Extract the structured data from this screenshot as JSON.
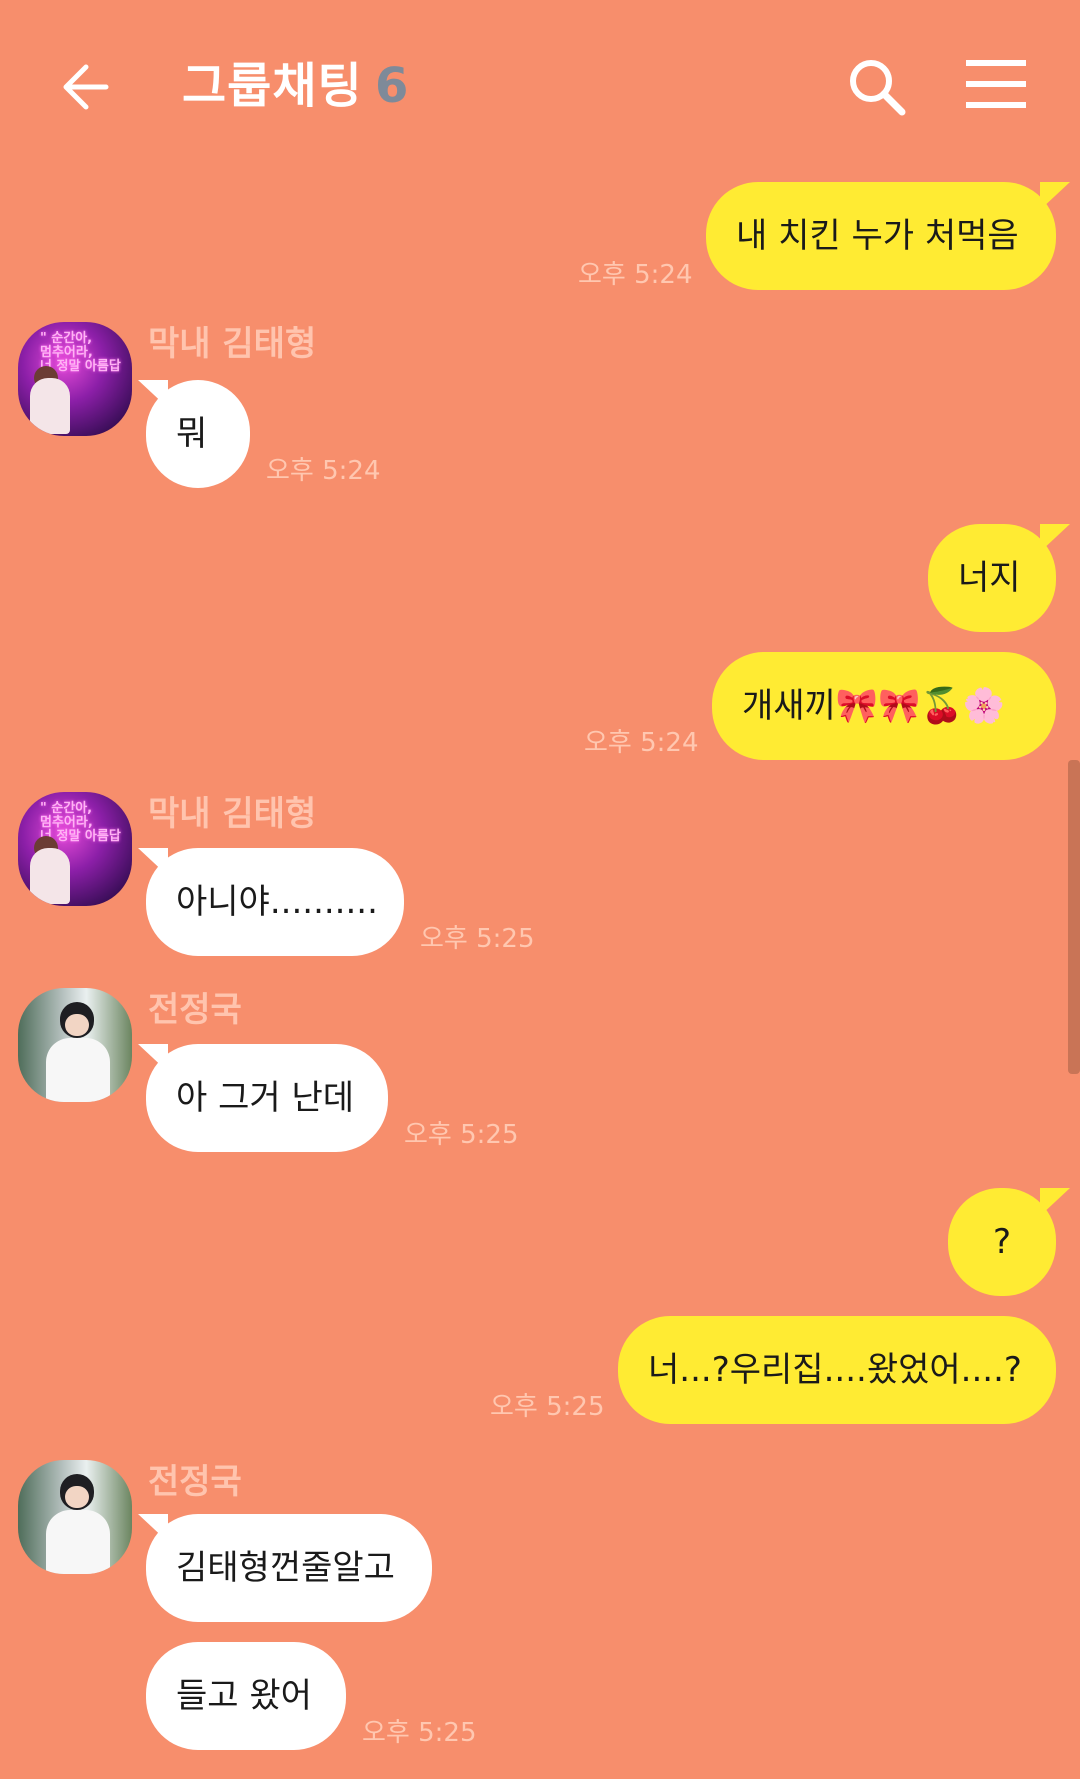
{
  "header": {
    "title": "그룹채팅",
    "member_count": "6",
    "icons": [
      "back-arrow-icon",
      "search-icon",
      "menu-icon"
    ]
  },
  "messages": [
    {
      "direction": "out",
      "text": "내 치킨 누가 처먹음",
      "time": "오후 5:24"
    },
    {
      "direction": "in",
      "sender": "막내 김태형",
      "text": "뭐",
      "time": "오후 5:24"
    },
    {
      "direction": "out",
      "text": "너지"
    },
    {
      "direction": "out",
      "text": "개새끼🎀🎀🍒🌸",
      "time": "오후 5:24"
    },
    {
      "direction": "in",
      "sender": "막내 김태형",
      "text": "아니야..........",
      "time": "오후 5:25"
    },
    {
      "direction": "in",
      "sender": "전정국",
      "text": "아 그거 난데",
      "time": "오후 5:25"
    },
    {
      "direction": "out",
      "text": "?"
    },
    {
      "direction": "out",
      "text": "너...?우리집....왔었어....?",
      "time": "오후 5:25"
    },
    {
      "direction": "in",
      "sender": "전정국",
      "text": "김태형껀줄알고"
    },
    {
      "direction": "in",
      "text": "들고 왔어",
      "time": "오후 5:25"
    }
  ],
  "colors": {
    "background": "#F78E6C",
    "outgoing_bubble": "#FFEB33",
    "incoming_bubble": "#FFFFFF",
    "member_count": "#7E8A99"
  }
}
